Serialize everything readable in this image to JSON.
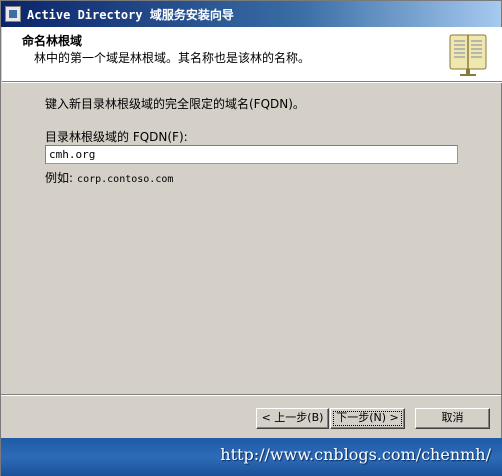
{
  "window": {
    "title": "Active Directory 域服务安装向导"
  },
  "header": {
    "title": "命名林根域",
    "subtitle": "林中的第一个域是林根域。其名称也是该林的名称。"
  },
  "form": {
    "instruction": "键入新目录林根级域的完全限定的域名(FQDN)。",
    "fqdn_label": "目录林根级域的 FQDN(F):",
    "fqdn_value": "cmh.org",
    "example_label": "例如:",
    "example_value": "corp.contoso.com"
  },
  "buttons": {
    "back": "< 上一步(B)",
    "next": "下一步(N) >",
    "cancel": "取消"
  },
  "watermark": "http://www.cnblogs.com/chenmh/",
  "colors": {
    "titlebar": "#0a246a",
    "dialog": "#d4d0c8",
    "footer": "#1f5aa6"
  },
  "icons": {
    "title": "wizard-app-icon",
    "header": "book-icon"
  }
}
